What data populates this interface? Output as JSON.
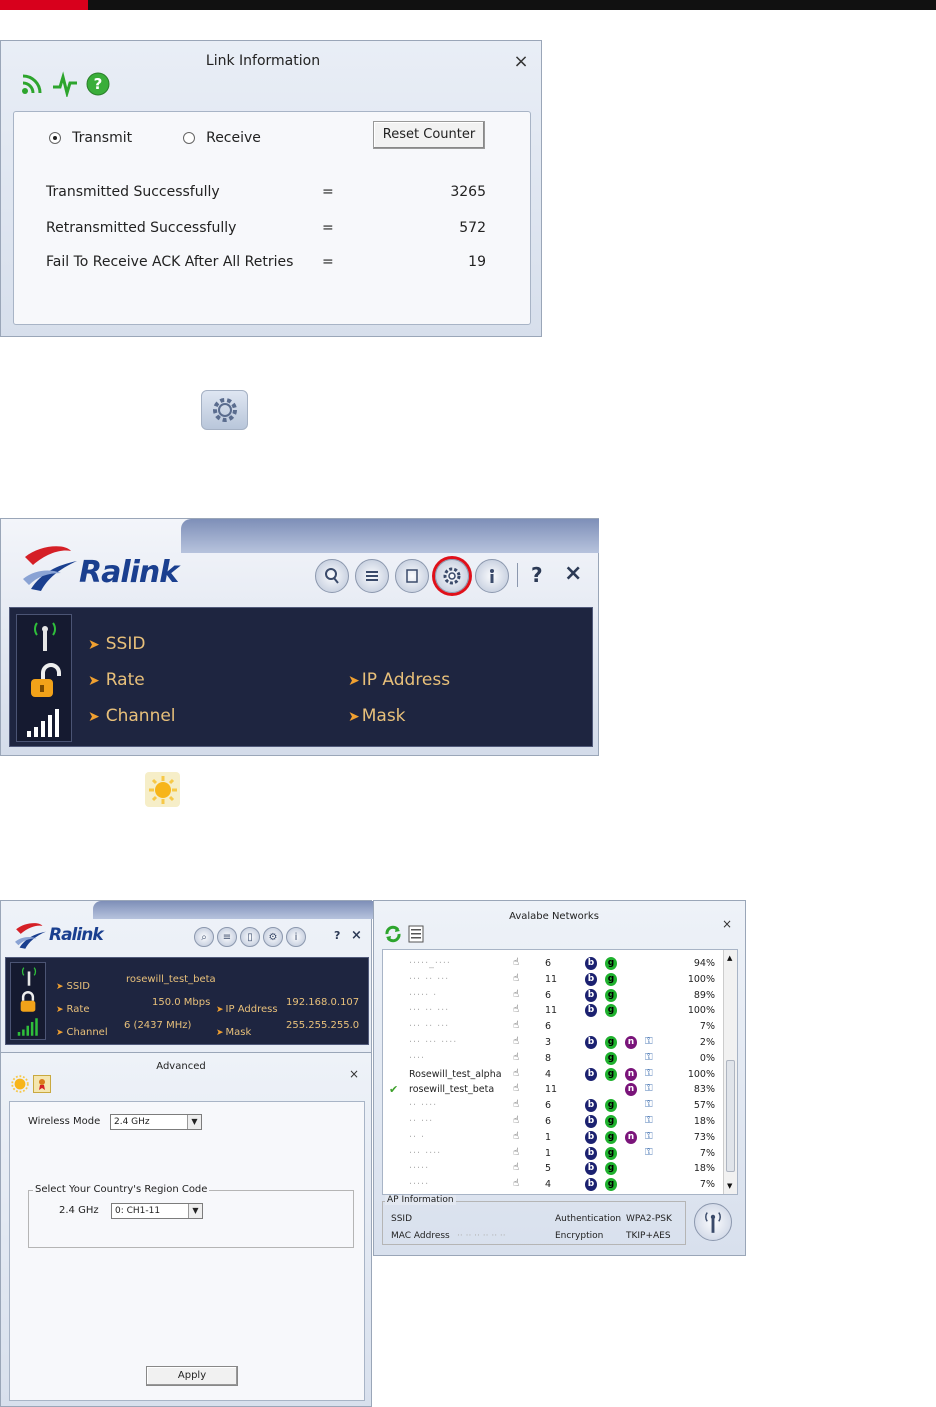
{
  "link_info": {
    "title": "Link Information",
    "close": "×",
    "transmit_label": "Transmit",
    "receive_label": "Receive",
    "reset_button": "Reset Counter",
    "stats": [
      {
        "name": "Transmitted Successfully",
        "eq": "=",
        "value": "3265"
      },
      {
        "name": "Retransmitted Successfully",
        "eq": "=",
        "value": "572"
      },
      {
        "name": "Fail To Receive ACK After All Retries",
        "eq": "=",
        "value": "19"
      }
    ]
  },
  "ralink": {
    "logo": "Ralink",
    "help": "?",
    "close": "×",
    "fields": {
      "ssid": "SSID",
      "rate": "Rate",
      "channel": "Channel",
      "ip": "IP Address",
      "mask": "Mask"
    }
  },
  "mini": {
    "logo": "Ralink",
    "help": "?",
    "close": "×",
    "ssid_label": "SSID",
    "ssid_value": "rosewill_test_beta",
    "rate_label": "Rate",
    "rate_value": "150.0 Mbps",
    "channel_label": "Channel",
    "channel_value": "6 (2437 MHz)",
    "ip_label": "IP Address",
    "ip_value": "192.168.0.107",
    "mask_label": "Mask",
    "mask_value": "255.255.255.0"
  },
  "advanced": {
    "title": "Advanced",
    "close": "×",
    "wireless_mode_label": "Wireless Mode",
    "wireless_mode_value": "2.4 GHz",
    "region_legend": "Select Your Country's Region Code",
    "band_label": "2.4 GHz",
    "region_value": "0: CH1-11",
    "apply": "Apply"
  },
  "networks": {
    "title": "Avalabe Networks",
    "close": "×",
    "rows": [
      {
        "ssid": "·····_····",
        "blur": true,
        "ch": "6",
        "b": true,
        "g": true,
        "n": false,
        "sec": false,
        "pct": "94%",
        "check": false
      },
      {
        "ssid": "··· ·· ···",
        "blur": true,
        "ch": "11",
        "b": true,
        "g": true,
        "n": false,
        "sec": false,
        "pct": "100%",
        "check": false
      },
      {
        "ssid": "·····  ·",
        "blur": true,
        "ch": "6",
        "b": true,
        "g": true,
        "n": false,
        "sec": false,
        "pct": "89%",
        "check": false
      },
      {
        "ssid": "··· ·· ···",
        "blur": true,
        "ch": "11",
        "b": true,
        "g": true,
        "n": false,
        "sec": false,
        "pct": "100%",
        "check": false
      },
      {
        "ssid": "··· ·· ···",
        "blur": true,
        "ch": "6",
        "b": false,
        "g": false,
        "n": false,
        "sec": false,
        "pct": "7%",
        "check": false
      },
      {
        "ssid": "··· ··· ····",
        "blur": true,
        "ch": "3",
        "b": true,
        "g": true,
        "n": true,
        "sec": true,
        "pct": "2%",
        "check": false
      },
      {
        "ssid": "····",
        "blur": true,
        "ch": "8",
        "b": false,
        "g": true,
        "n": false,
        "sec": true,
        "pct": "0%",
        "check": false
      },
      {
        "ssid": "Rosewill_test_alpha",
        "blur": false,
        "ch": "4",
        "b": true,
        "g": true,
        "n": true,
        "sec": true,
        "pct": "100%",
        "check": false
      },
      {
        "ssid": "rosewill_test_beta",
        "blur": false,
        "ch": "11",
        "b": false,
        "g": false,
        "n": true,
        "sec": true,
        "pct": "83%",
        "check": true
      },
      {
        "ssid": "·· ····",
        "blur": true,
        "ch": "6",
        "b": true,
        "g": true,
        "n": false,
        "sec": true,
        "pct": "57%",
        "check": false
      },
      {
        "ssid": "·· ···",
        "blur": true,
        "ch": "6",
        "b": true,
        "g": true,
        "n": false,
        "sec": true,
        "pct": "18%",
        "check": false
      },
      {
        "ssid": "·· ·",
        "blur": true,
        "ch": "1",
        "b": true,
        "g": true,
        "n": true,
        "sec": true,
        "pct": "73%",
        "check": false
      },
      {
        "ssid": "··· ····",
        "blur": true,
        "ch": "1",
        "b": true,
        "g": true,
        "n": false,
        "sec": true,
        "pct": "7%",
        "check": false
      },
      {
        "ssid": "·····",
        "blur": true,
        "ch": "5",
        "b": true,
        "g": true,
        "n": false,
        "sec": false,
        "pct": "18%",
        "check": false
      },
      {
        "ssid": "·····",
        "blur": true,
        "ch": "4",
        "b": true,
        "g": true,
        "n": false,
        "sec": false,
        "pct": "7%",
        "check": false
      }
    ],
    "ap_legend": "AP Information",
    "ap_ssid_label": "SSID",
    "ap_mac_label": "MAC Address",
    "ap_mac_value": "·· ·· ·· ·· ·· ··",
    "ap_auth_label": "Authentication",
    "ap_auth_value": "WPA2-PSK",
    "ap_enc_label": "Encryption",
    "ap_enc_value": "TKIP+AES"
  }
}
